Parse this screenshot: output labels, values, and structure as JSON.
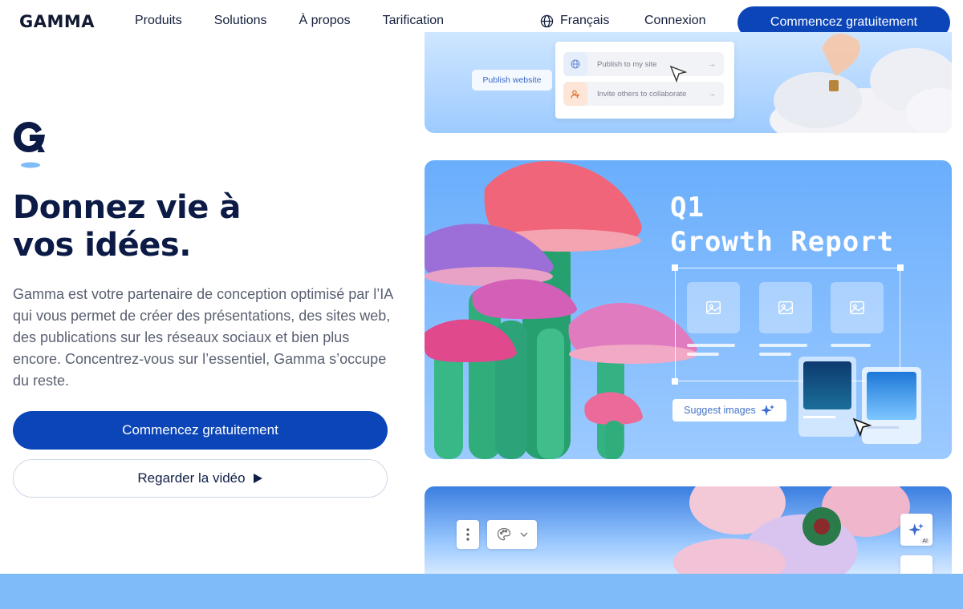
{
  "brand": {
    "logo": "GAMMA"
  },
  "nav": {
    "links": [
      "Produits",
      "Solutions",
      "À propos",
      "Tarification"
    ],
    "language": "Français",
    "login": "Connexion",
    "cta": "Commencez gratuitement"
  },
  "hero": {
    "title_line1": "Donnez vie à",
    "title_line2": "vos idées.",
    "description": "Gamma est votre partenaire de conception optimisé par l’IA qui vous permet de créer des présentations, des sites web, des publications sur les réseaux sociaux et bien plus encore. Concentrez-vous sur l’essentiel, Gamma s’occupe du reste.",
    "primary_button": "Commencez gratuitement",
    "secondary_button": "Regarder la vidéo"
  },
  "showcase": {
    "publish_button": "Publish website",
    "share_options": [
      "Publish to my site",
      "Invite others to collaborate"
    ],
    "report_line1": "Q1",
    "report_line2": "Growth Report",
    "suggest_button": "Suggest images",
    "ai_badge": "AI"
  },
  "colors": {
    "primary": "#0b45b8",
    "heading": "#0b1b45",
    "body_text": "#5a6072",
    "accent_blue": "#7fbcf7"
  }
}
